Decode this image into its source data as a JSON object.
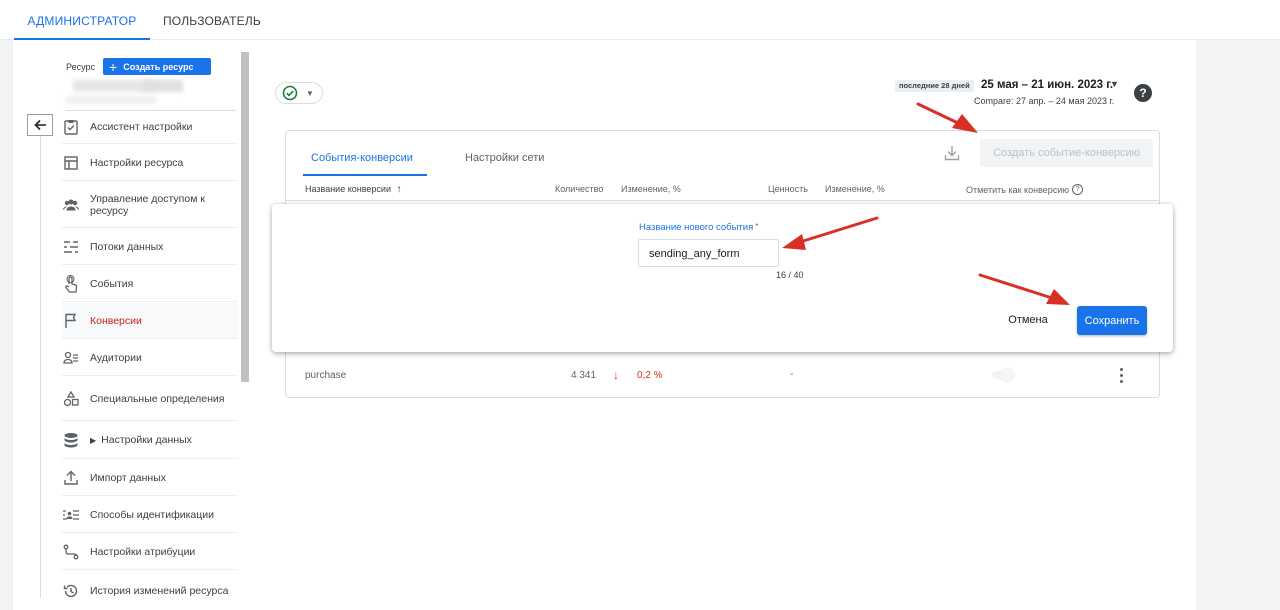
{
  "top_tabs": {
    "admin": "АДМИНИСТРАТОР",
    "user": "ПОЛЬЗОВАТЕЛЬ"
  },
  "sidebar": {
    "resource_label": "Ресурс",
    "create_resource": "Создать ресурс",
    "items": [
      {
        "label": "Ассистент настройки",
        "icon": "checklist-icon"
      },
      {
        "label": "Настройки ресурса",
        "icon": "property-settings-icon"
      },
      {
        "label": "Управление доступом к ресурсу",
        "icon": "people-icon"
      },
      {
        "label": "Потоки данных",
        "icon": "data-streams-icon"
      },
      {
        "label": "События",
        "icon": "touch-icon"
      },
      {
        "label": "Конверсии",
        "icon": "flag-icon",
        "active": true
      },
      {
        "label": "Аудитории",
        "icon": "audience-icon"
      },
      {
        "label": "Специальные определения",
        "icon": "shapes-icon"
      },
      {
        "label": "Настройки данных",
        "icon": "database-icon"
      },
      {
        "label": "Импорт данных",
        "icon": "upload-icon"
      },
      {
        "label": "Способы идентификации",
        "icon": "identity-icon"
      },
      {
        "label": "Настройки атрибуции",
        "icon": "attribution-icon"
      },
      {
        "label": "История изменений ресурса",
        "icon": "history-icon"
      }
    ]
  },
  "header": {
    "date_chip": "последние 28 дней",
    "date_range": "25 мая – 21 июн. 2023 г.",
    "compare": "Compare: 27 апр. – 24 мая 2023 г."
  },
  "card": {
    "tabs": [
      "События-конверсии",
      "Настройки сети"
    ],
    "create_event_button": "Создать событие-конверсию",
    "columns": [
      "Название конверсии",
      "Количество",
      "Изменение, %",
      "Ценность",
      "Изменение, %",
      "Отметить как конверсию"
    ],
    "rows": [
      {
        "name": "purchase",
        "count": "4 341",
        "change": "0,2 %",
        "value": "-"
      }
    ]
  },
  "dialog": {
    "field_label": "Название нового события",
    "required_mark": "*",
    "field_value": "sending_any_form",
    "char_count": "16 / 40",
    "cancel": "Отмена",
    "save": "Сохранить"
  },
  "colors": {
    "accent": "#1a73e8",
    "active_nav": "#c5221f",
    "annotation_arrow": "#d93025",
    "success": "#188038"
  }
}
